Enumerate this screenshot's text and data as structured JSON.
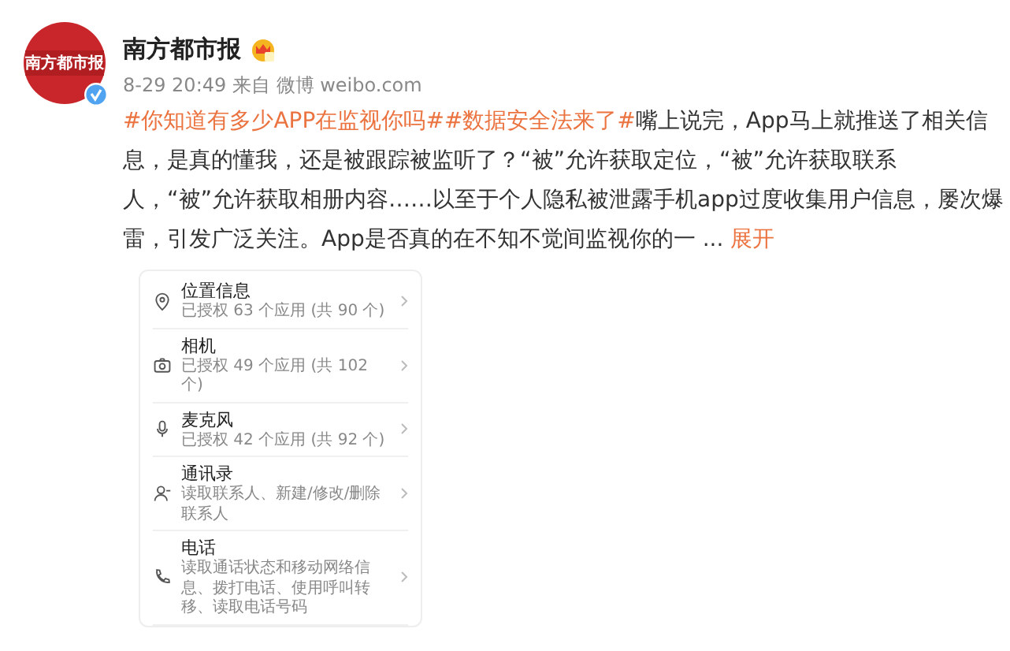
{
  "post": {
    "avatar_logo": "南方都市报",
    "author": "南方都市报",
    "verified": true,
    "time": "8-29 20:49",
    "source": "来自 微博 weibo.com",
    "body": [
      {
        "kind": "hashtag",
        "text": "#你知道有多少APP在监视你吗#"
      },
      {
        "kind": "hashtag",
        "text": "#数据安全法来了#"
      },
      {
        "kind": "text",
        "text": "嘴上说完，App马上就推送了相关信息，是真的懂我，还是被跟踪被监听了？“被”允许获取定位，“被”允许获取联系人，“被”允许获取相册内容……以至于个人隐私被泄露手机app过度收集用户信息，屡次爆雷，引发广泛关注。App是否真的在不知不觉间监视你的一 "
      },
      {
        "kind": "text",
        "text": " ... "
      },
      {
        "kind": "link",
        "text": "展开"
      }
    ]
  },
  "permissions": [
    {
      "title": "位置信息",
      "detail": "已授权 63 个应用 (共 90 个)"
    },
    {
      "title": "相机",
      "detail": "已授权 49 个应用 (共 102 个)"
    },
    {
      "title": "麦克风",
      "detail": "已授权 42 个应用 (共 92 个)"
    },
    {
      "title": "通讯录",
      "detail": "读取联系人、新建/修改/删除联系人"
    },
    {
      "title": "电话",
      "detail": "读取通话状态和移动网络信息、拨打电话、使用呼叫转移、读取电话号码"
    }
  ]
}
